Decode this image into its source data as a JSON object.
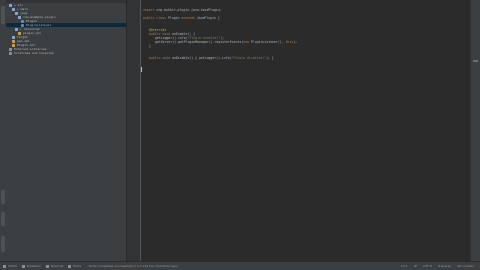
{
  "project_tree": {
    "rows": [
      {
        "label": "▸ src",
        "icon": "folder",
        "indent": 3
      },
      {
        "label": "▸ main",
        "icon": "folder",
        "indent": 6
      },
      {
        "label": "java",
        "icon": "folder",
        "indent": 9
      },
      {
        "label": "com.example.plugin",
        "icon": "folder",
        "indent": 12
      },
      {
        "label": "Plugin",
        "icon": "java",
        "indent": 15
      },
      {
        "label": "PluginListener",
        "icon": "java",
        "indent": 15,
        "selected": true
      },
      {
        "label": "▸ resources",
        "icon": "folder",
        "indent": 9
      },
      {
        "label": "plugin.yml",
        "icon": "file",
        "indent": 12
      },
      {
        "label": "target",
        "icon": "folder",
        "indent": 6
      },
      {
        "label": "pom.xml",
        "icon": "file",
        "indent": 6
      },
      {
        "label": "Plugin.iml",
        "icon": "file",
        "indent": 6
      },
      {
        "label": "External Libraries",
        "icon": "lib",
        "indent": 3
      },
      {
        "label": "Scratches and Consoles",
        "icon": "ext",
        "indent": 3
      }
    ]
  },
  "editor": {
    "lines": [
      {
        "row": 2,
        "indent": 0,
        "parts": [
          {
            "t": "import ",
            "c": "kw"
          },
          {
            "t": "org.bukkit.plugin.java.JavaPlugin;",
            "c": "cls"
          }
        ]
      },
      {
        "row": 4,
        "indent": 0,
        "parts": [
          {
            "t": "public class ",
            "c": "kw"
          },
          {
            "t": "Plugin ",
            "c": "cls"
          },
          {
            "t": "extends ",
            "c": "kw"
          },
          {
            "t": "JavaPlugin {",
            "c": "cls"
          }
        ]
      },
      {
        "row": 7,
        "indent": 2,
        "parts": [
          {
            "t": "@Override",
            "c": "ann"
          }
        ]
      },
      {
        "row": 8,
        "indent": 2,
        "parts": [
          {
            "t": "public void ",
            "c": "kw"
          },
          {
            "t": "onEnable() {",
            "c": "cls"
          }
        ]
      },
      {
        "row": 9,
        "indent": 4,
        "parts": [
          {
            "t": "getLogger().info(",
            "c": "cls"
          },
          {
            "t": "\"Plugin enabled!\"",
            "c": "str"
          },
          {
            "t": ");",
            "c": "cls"
          }
        ]
      },
      {
        "row": 10,
        "indent": 4,
        "parts": [
          {
            "t": "getServer().getPluginManager().registerEvents(",
            "c": "cls"
          },
          {
            "t": "new ",
            "c": "kw"
          },
          {
            "t": "PluginListener(), ",
            "c": "cls"
          },
          {
            "t": "this",
            "c": "kw"
          },
          {
            "t": ");",
            "c": "cls"
          }
        ]
      },
      {
        "row": 11,
        "indent": 2,
        "parts": [
          {
            "t": "}",
            "c": "cls"
          }
        ]
      },
      {
        "row": 14,
        "indent": 2,
        "parts": [
          {
            "t": "public void ",
            "c": "kw"
          },
          {
            "t": "onDisable() { getLogger().info(",
            "c": "cls"
          },
          {
            "t": "\"Plugin disabled!\"",
            "c": "str"
          },
          {
            "t": "); }",
            "c": "cls"
          }
        ]
      },
      {
        "row": 16,
        "indent": 0,
        "parts": [
          {
            "t": "",
            "c": "cls"
          }
        ]
      }
    ]
  },
  "status_bar": {
    "tabs": [
      "TODO",
      "Problems",
      "Terminal",
      "Build"
    ],
    "message": "Build completed successfully in 2 s 144 ms (moments ago)",
    "position": "17:1",
    "line_sep": "LF",
    "encoding": "UTF-8",
    "indent": "4 spaces",
    "vcs": "Git: master"
  }
}
